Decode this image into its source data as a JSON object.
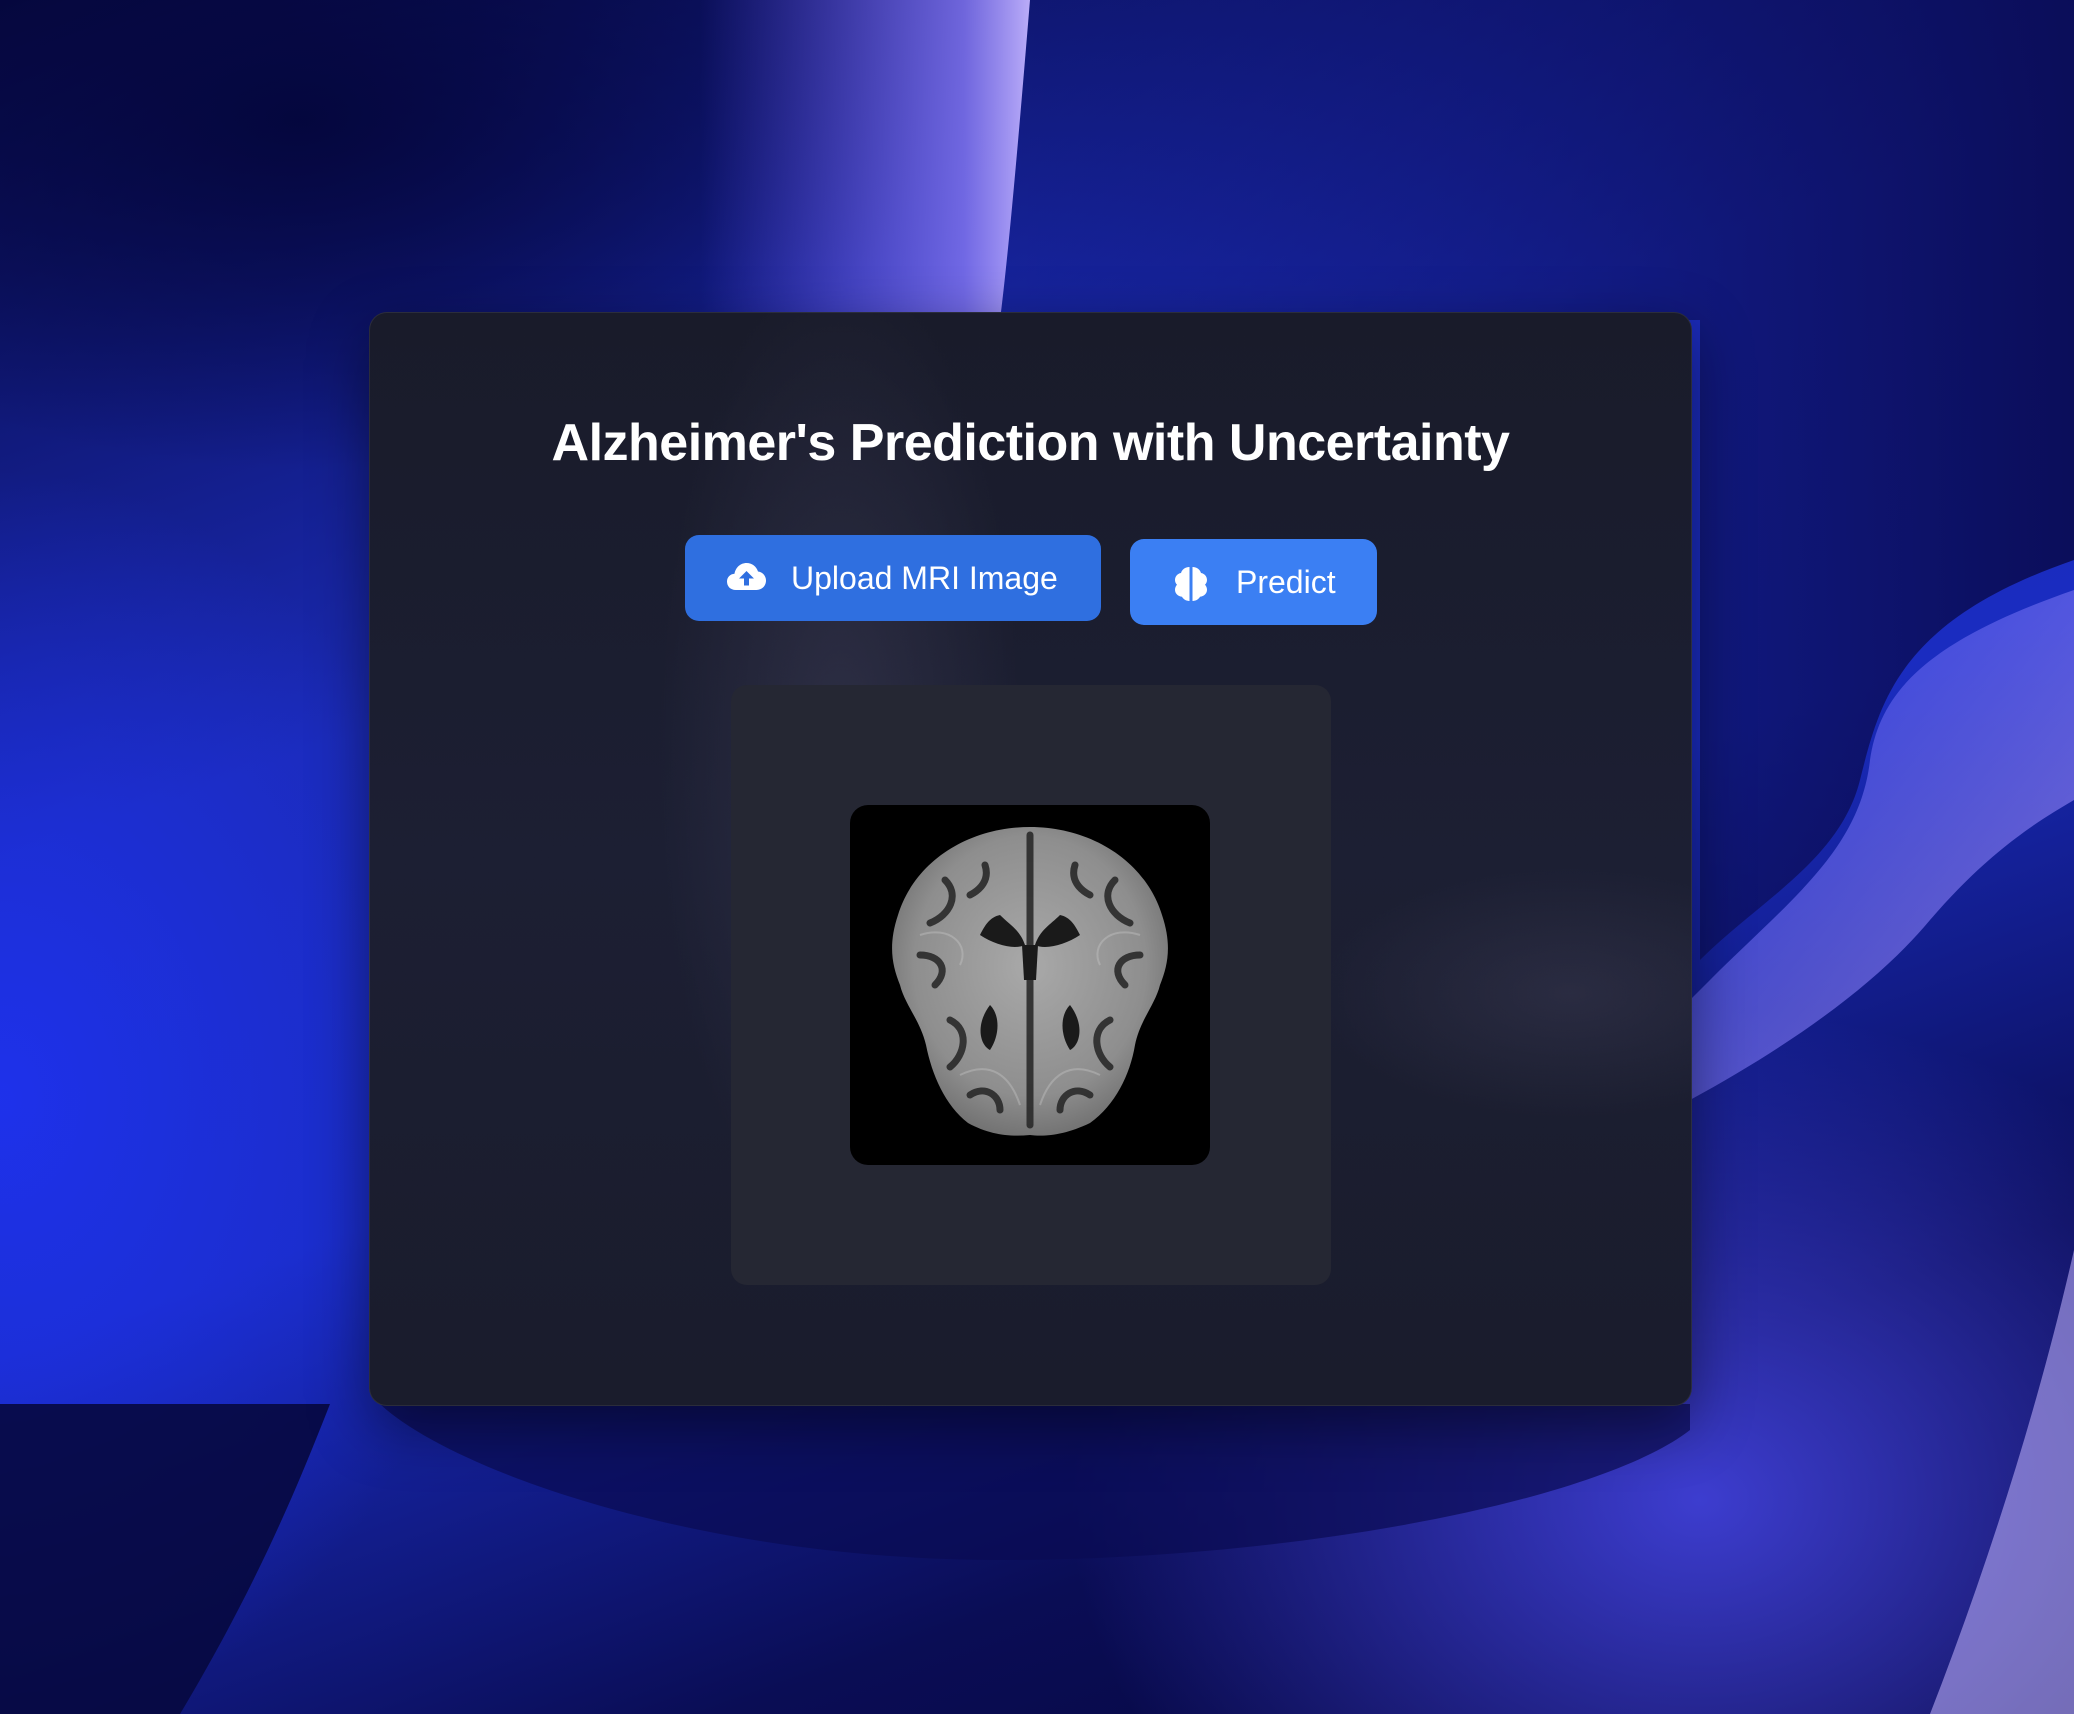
{
  "page": {
    "title": "Alzheimer's Prediction with Uncertainty"
  },
  "actions": {
    "upload_label": "Upload MRI Image",
    "upload_icon": "cloud-upload-icon",
    "predict_label": "Predict",
    "predict_icon": "brain-icon"
  },
  "preview": {
    "image": "mri-brain-scan"
  },
  "colors": {
    "upload_button": "#2f6fe0",
    "predict_button": "#3b7ff3",
    "card_background": "#1b1d2d",
    "preview_background": "#252733",
    "title_text": "#ffffff"
  }
}
